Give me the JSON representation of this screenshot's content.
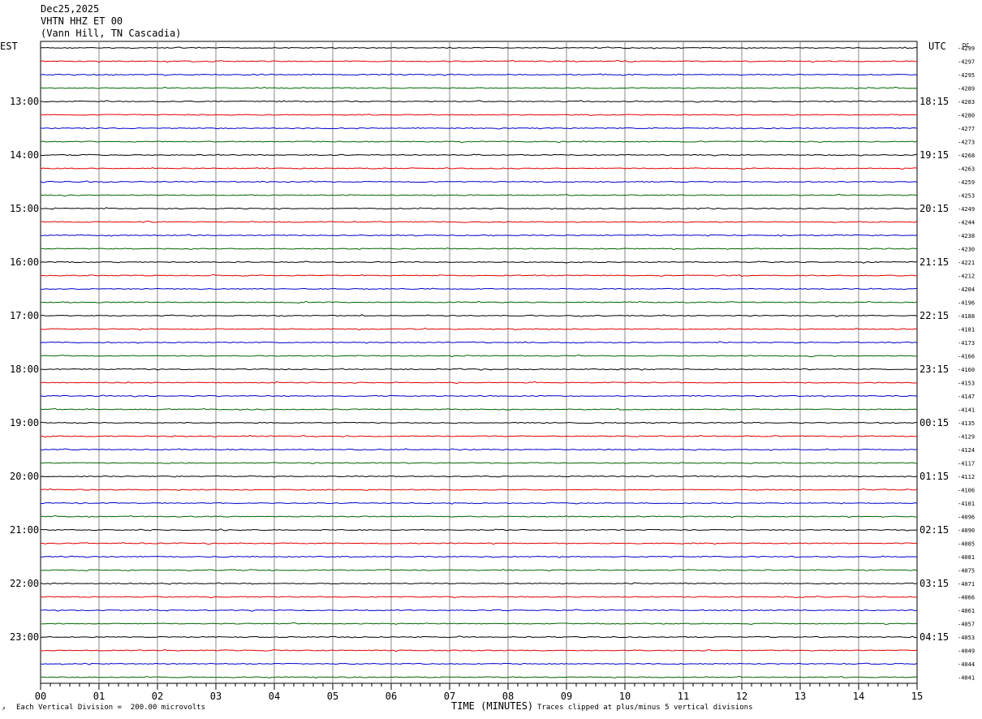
{
  "header": {
    "date": "Dec25,2025",
    "station": "VHTN HHZ ET 00",
    "location": "(Vann Hill, TN Cascadia)"
  },
  "labels": {
    "left_zone": "EST",
    "right_zone": "UTC",
    "dc": "DC",
    "xlabel": "TIME (MINUTES)",
    "scale_note": "Each Vertical Division =  200.00 microvolts",
    "clip_note": "Traces clipped at plus/minus 5 vertical divisions",
    "corner_mark": "↗"
  },
  "chart_data": {
    "type": "line",
    "xlabel": "TIME (MINUTES)",
    "xlim": [
      0,
      15
    ],
    "x_ticks": [
      "00",
      "01",
      "02",
      "03",
      "04",
      "05",
      "06",
      "07",
      "08",
      "09",
      "10",
      "11",
      "12",
      "13",
      "14",
      "15"
    ],
    "trace_colors": [
      "#000000",
      "#e00000",
      "#0000c8",
      "#006400"
    ],
    "trace_count": 48,
    "left_hour_labels": [
      "13:00",
      "14:00",
      "15:00",
      "16:00",
      "17:00",
      "18:00",
      "19:00",
      "20:00",
      "21:00",
      "22:00",
      "23:00"
    ],
    "right_hour_labels": [
      "18:15",
      "19:15",
      "20:15",
      "21:15",
      "22:15",
      "23:15",
      "00:15",
      "01:15",
      "02:15",
      "03:15",
      "04:15"
    ],
    "dc_offsets": [
      "-4299",
      "-4297",
      "-4295",
      "-4289",
      "-4283",
      "-4280",
      "-4277",
      "-4273",
      "-4268",
      "-4263",
      "-4259",
      "-4253",
      "-4249",
      "-4244",
      "-4238",
      "-4230",
      "-4221",
      "-4212",
      "-4204",
      "-4196",
      "-4188",
      "-4181",
      "-4173",
      "-4166",
      "-4160",
      "-4153",
      "-4147",
      "-4141",
      "-4135",
      "-4129",
      "-4124",
      "-4117",
      "-4112",
      "-4106",
      "-4101",
      "-4096",
      "-4090",
      "-4085",
      "-4081",
      "-4075",
      "-4071",
      "-4066",
      "-4061",
      "-4057",
      "-4053",
      "-4049",
      "-4044",
      "-4041"
    ]
  }
}
